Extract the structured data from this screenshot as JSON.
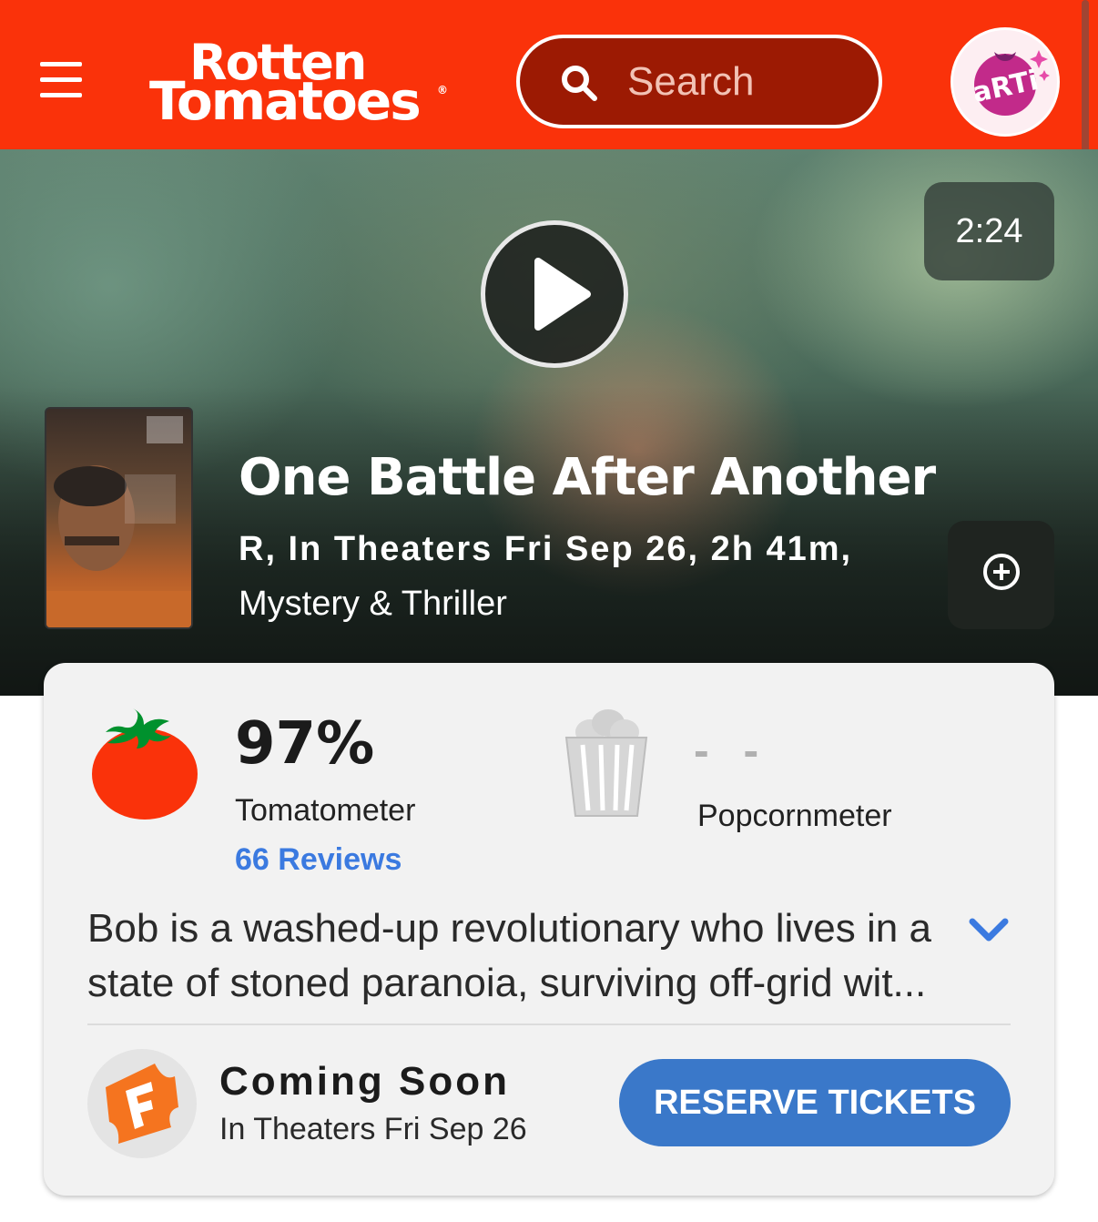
{
  "header": {
    "logo_line1": "Rotten",
    "logo_line2": "Tomatoes",
    "search_placeholder": "Search",
    "avatar_text": "aRTi",
    "brand_color": "#fa320a"
  },
  "hero": {
    "duration": "2:24",
    "title": "One Battle After Another",
    "meta_line1": "R, In Theaters Fri Sep 26, 2h 41m,",
    "meta_line2": "Mystery & Thriller"
  },
  "scores": {
    "tomatometer_value": "97%",
    "tomatometer_label": "Tomatometer",
    "reviews_link": "66 Reviews",
    "popcornmeter_value": "- -",
    "popcornmeter_label": "Popcornmeter"
  },
  "synopsis": "Bob is a washed-up revolutionary who lives in a state of stoned paranoia, surviving off-grid wit...",
  "tickets": {
    "status": "Coming Soon",
    "date": "In Theaters Fri Sep 26",
    "button_label": "RESERVE TICKETS",
    "button_color": "#3a78c9"
  },
  "icons": [
    "menu-icon",
    "search-icon",
    "play-icon",
    "add-icon",
    "tomato-icon",
    "popcorn-icon",
    "chevron-down-icon",
    "fandango-icon"
  ]
}
